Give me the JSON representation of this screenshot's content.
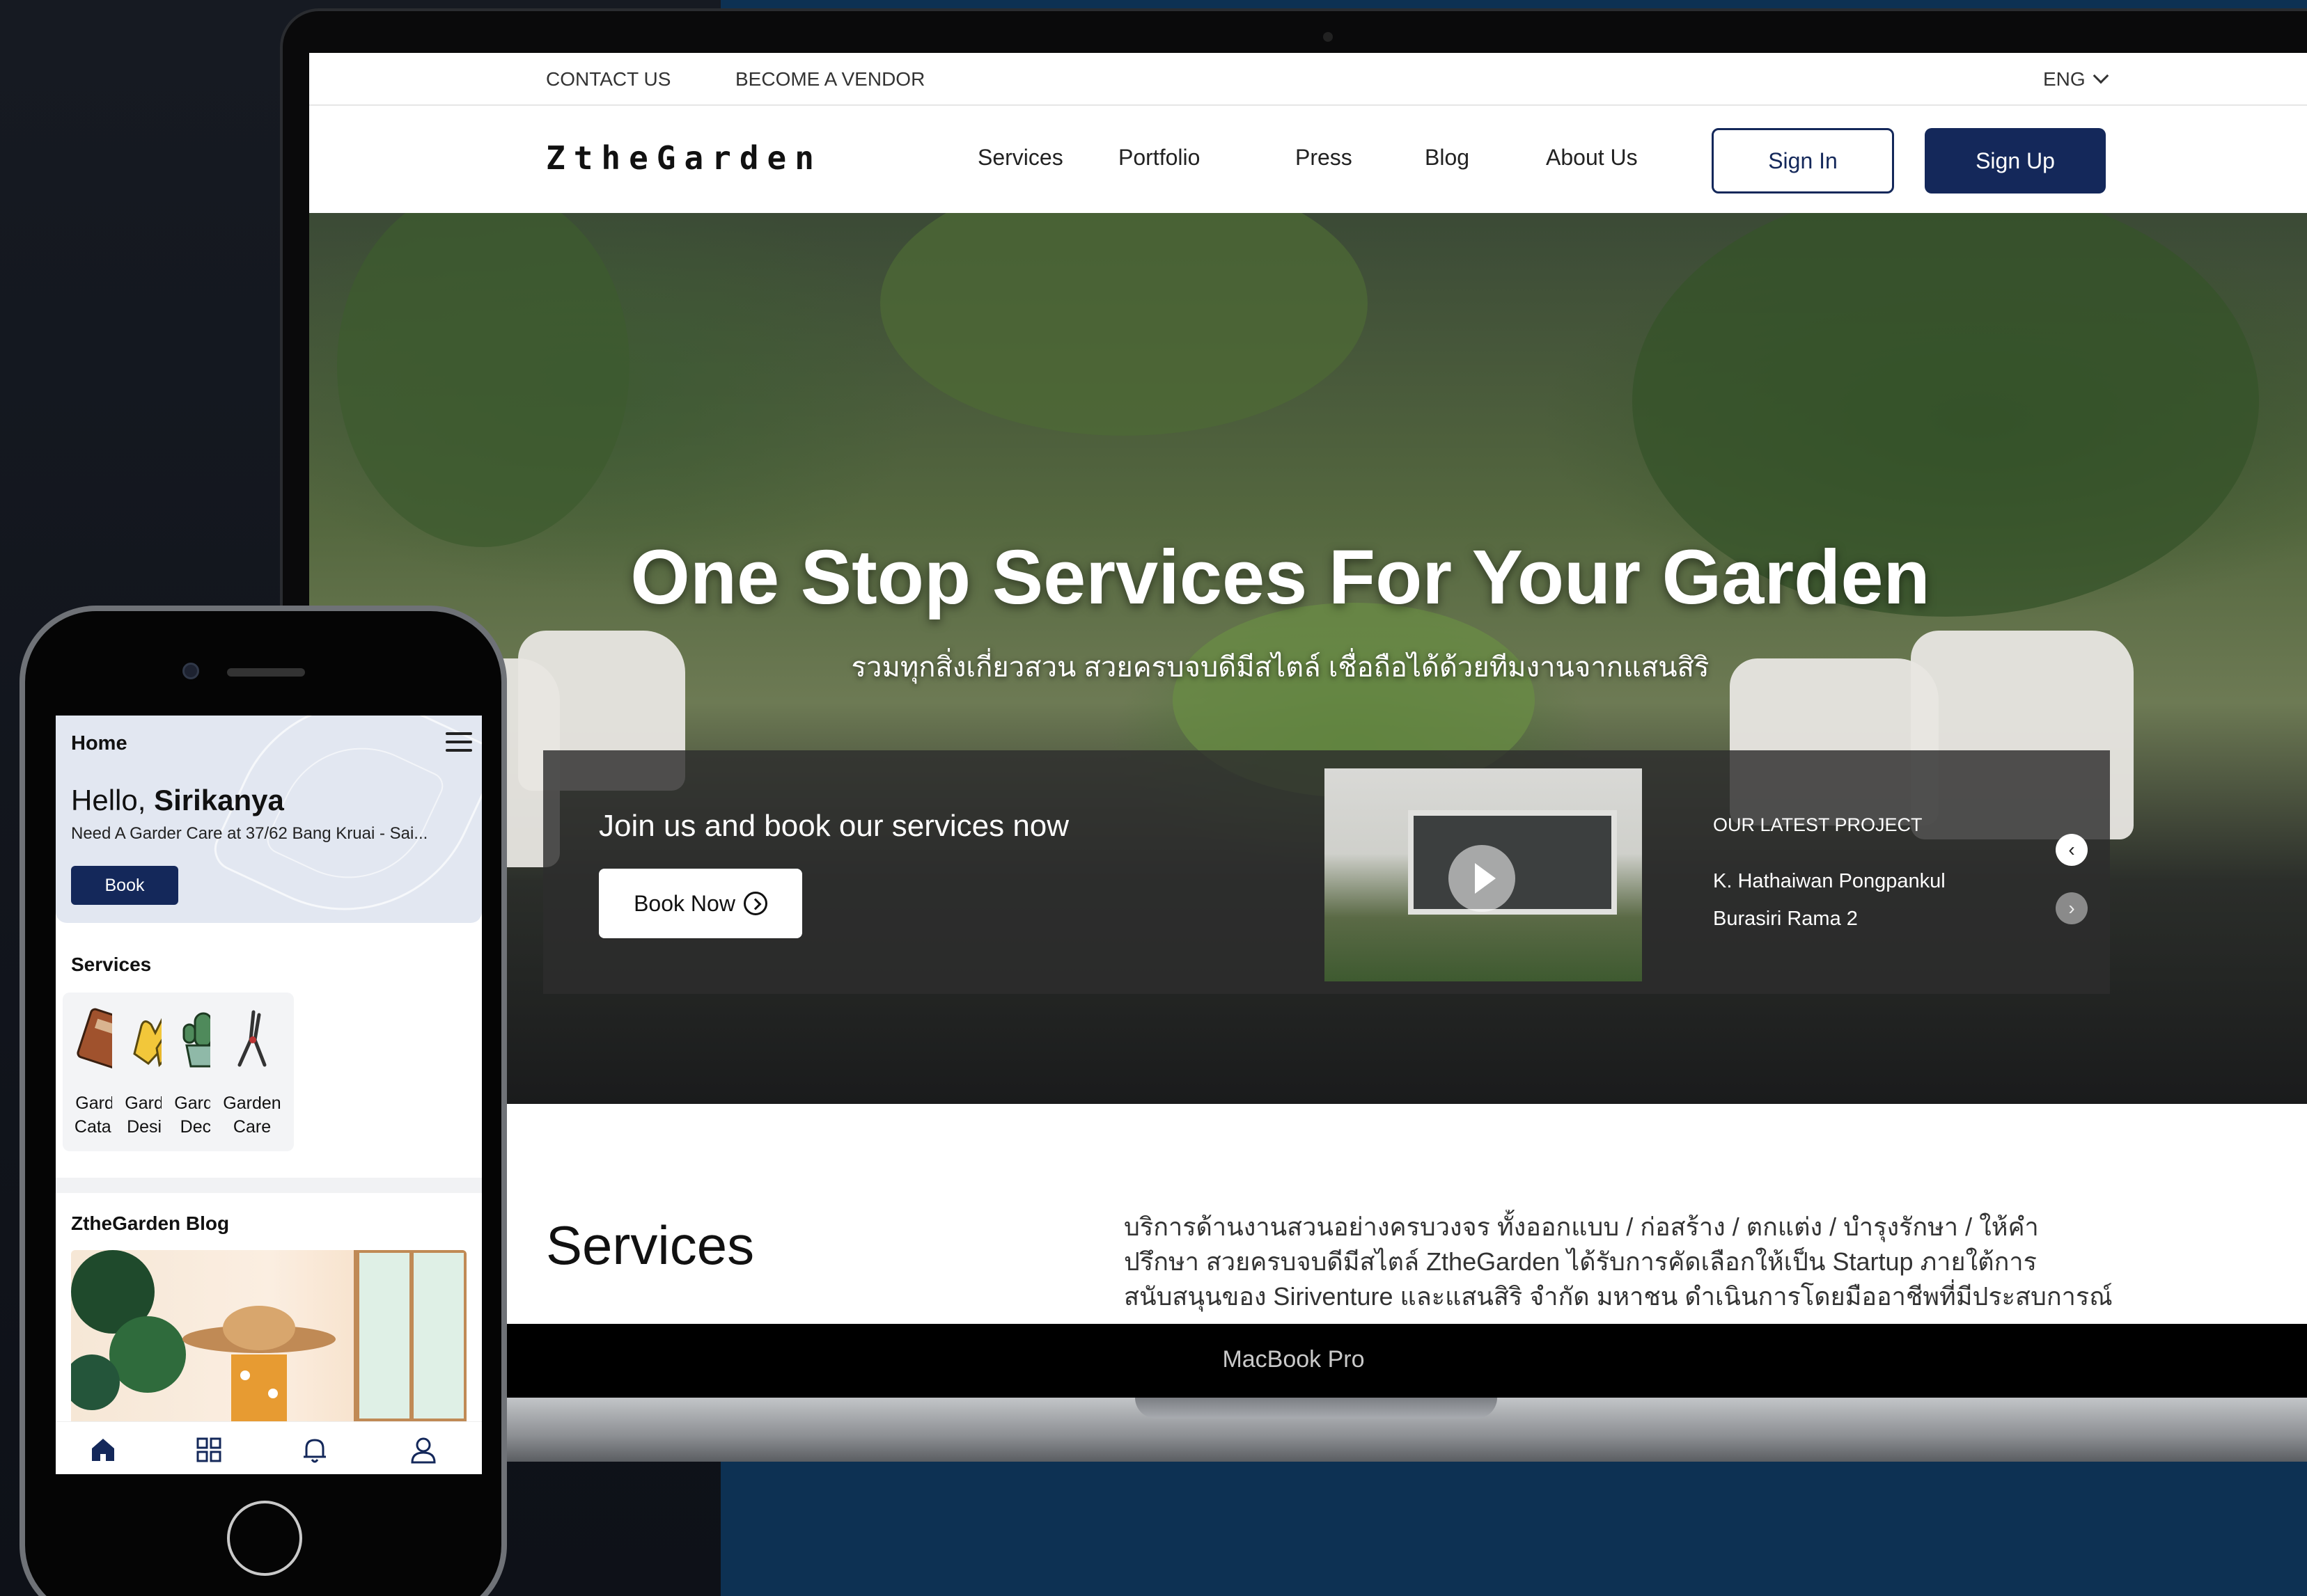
{
  "laptop": {
    "brand_label": "MacBook Pro",
    "topbar": {
      "contact": "CONTACT US",
      "vendor": "BECOME A VENDOR",
      "language": "ENG"
    },
    "nav": {
      "logo": "ZtheGarden",
      "items": [
        "Services",
        "Portfolio",
        "Press",
        "Blog",
        "About Us"
      ],
      "sign_in": "Sign In",
      "sign_up": "Sign Up"
    },
    "hero": {
      "title": "One Stop Services For Your Garden",
      "subtitle": "รวมทุกสิ่งเกี่ยวสวน สวยครบจบดีมีสไตล์ เชื่อถือได้ด้วยทีมงานจากแสนสิริ"
    },
    "booking": {
      "heading": "Join us and book our services now",
      "button": "Book Now",
      "latest_label": "OUR LATEST PROJECT",
      "latest_name": "K. Hathaiwan Pongpankul",
      "latest_place": "Burasiri Rama 2",
      "prev_icon": "‹",
      "next_icon": "›"
    },
    "services": {
      "title": "Services",
      "description": "บริการด้านงานสวนอย่างครบวงจร ทั้งออกแบบ / ก่อสร้าง / ตกแต่ง / บำรุงรักษา / ให้คำปรึกษา สวยครบจบดีมีสไตล์ ZtheGarden ได้รับการคัดเลือกให้เป็น Startup ภายใต้การสนับสนุนของ Siriventure และแสนสิริ จำกัด มหาชน ดำเนินการโดยมืออาชีพที่มีประสบการณ์ เชื่อถือได้ด้วยทีม"
    }
  },
  "phone": {
    "header": {
      "title": "Home",
      "greeting": "Hello,",
      "user_name": "Sirikanya",
      "note": "Need A Garder Care at 37/62 Bang Kruai - Sai...",
      "book": "Book"
    },
    "services_title": "Services",
    "services": [
      {
        "line1": "Garden",
        "line2": "Catalog",
        "icon": "notebook-icon"
      },
      {
        "line1": "Garden",
        "line2": "Design",
        "icon": "gloves-icon"
      },
      {
        "line1": "Garden",
        "line2": "Decor",
        "icon": "cactus-pot-icon"
      },
      {
        "line1": "Garden",
        "line2": "Care",
        "icon": "pruning-shears-icon"
      }
    ],
    "blog_title": "ZtheGarden Blog",
    "tabs": [
      "home-icon",
      "grid-icon",
      "bell-icon",
      "user-icon"
    ]
  },
  "colors": {
    "brand": "#14285a",
    "right_background": "#0d3153",
    "left_background": "#0f1219"
  }
}
